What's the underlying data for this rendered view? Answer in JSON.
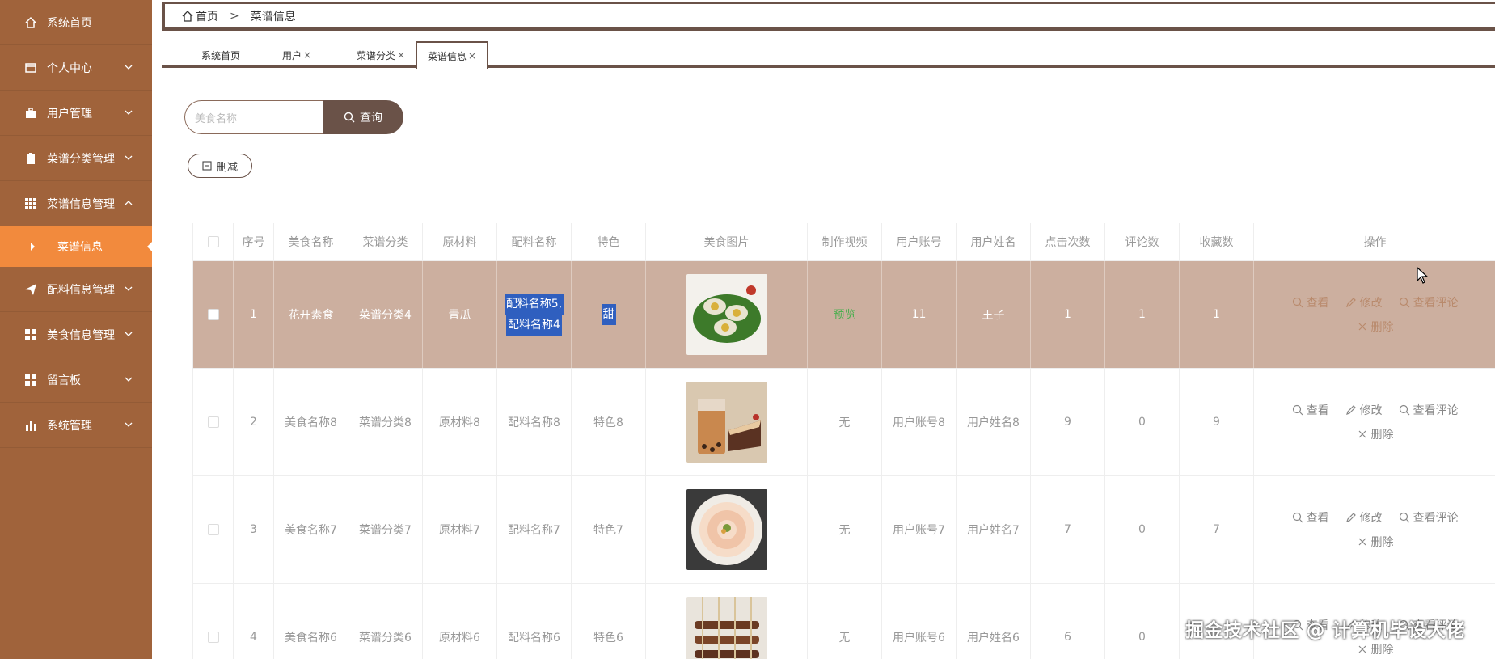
{
  "sidebar": {
    "items": [
      {
        "label": "系统首页",
        "icon": "home-icon"
      },
      {
        "label": "个人中心",
        "icon": "wallet-icon"
      },
      {
        "label": "用户管理",
        "icon": "briefcase-icon"
      },
      {
        "label": "菜谱分类管理",
        "icon": "clipboard-icon"
      },
      {
        "label": "菜谱信息管理",
        "icon": "grid-icon"
      },
      {
        "label": "配料信息管理",
        "icon": "paper-plane-icon"
      },
      {
        "label": "美食信息管理",
        "icon": "apps-icon"
      },
      {
        "label": "留言板",
        "icon": "apps-icon"
      },
      {
        "label": "系统管理",
        "icon": "bar-chart-icon"
      }
    ],
    "active_sub": "菜谱信息"
  },
  "breadcrumb": {
    "home": "首页",
    "sep": ">",
    "current": "菜谱信息"
  },
  "tabs": [
    {
      "label": "系统首页",
      "closable": false
    },
    {
      "label": "用户",
      "closable": true
    },
    {
      "label": "菜谱分类",
      "closable": true
    },
    {
      "label": "菜谱信息",
      "closable": true
    }
  ],
  "tab_close_glyph": "×",
  "search": {
    "placeholder": "美食名称",
    "button": "查询"
  },
  "delete_button": "删减",
  "table": {
    "headers": [
      "序号",
      "美食名称",
      "菜谱分类",
      "原材料",
      "配料名称",
      "特色",
      "美食图片",
      "制作视频",
      "用户账号",
      "用户姓名",
      "点击次数",
      "评论数",
      "收藏数",
      "操作"
    ],
    "rows": [
      {
        "no": "1",
        "name": "花开素食",
        "category": "菜谱分类4",
        "material": "青瓜",
        "ingredient_1": "配料名称5,",
        "ingredient_2": "配料名称4",
        "feature": "甜",
        "video": "预览",
        "account": "11",
        "username": "王子",
        "clicks": "1",
        "comments": "1",
        "favorites": "1"
      },
      {
        "no": "2",
        "name": "美食名称8",
        "category": "菜谱分类8",
        "material": "原材料8",
        "ingredient_1": "配料名称8",
        "ingredient_2": "",
        "feature": "特色8",
        "video": "无",
        "account": "用户账号8",
        "username": "用户姓名8",
        "clicks": "9",
        "comments": "0",
        "favorites": "9"
      },
      {
        "no": "3",
        "name": "美食名称7",
        "category": "菜谱分类7",
        "material": "原材料7",
        "ingredient_1": "配料名称7",
        "ingredient_2": "",
        "feature": "特色7",
        "video": "无",
        "account": "用户账号7",
        "username": "用户姓名7",
        "clicks": "7",
        "comments": "0",
        "favorites": "7"
      },
      {
        "no": "4",
        "name": "美食名称6",
        "category": "菜谱分类6",
        "material": "原材料6",
        "ingredient_1": "配料名称6",
        "ingredient_2": "",
        "feature": "特色6",
        "video": "无",
        "account": "用户账号6",
        "username": "用户姓名6",
        "clicks": "6",
        "comments": "0",
        "favorites": ""
      }
    ],
    "actions": {
      "view": "查看",
      "edit": "修改",
      "comments": "查看评论",
      "delete": "删除"
    }
  },
  "watermark": "掘金技术社区 @ 计算机毕设大佬",
  "colors": {
    "sidebar": "#a0633b",
    "active": "#f28a3d",
    "accent": "#6a5248",
    "selected_row": "#ccaf9f"
  }
}
